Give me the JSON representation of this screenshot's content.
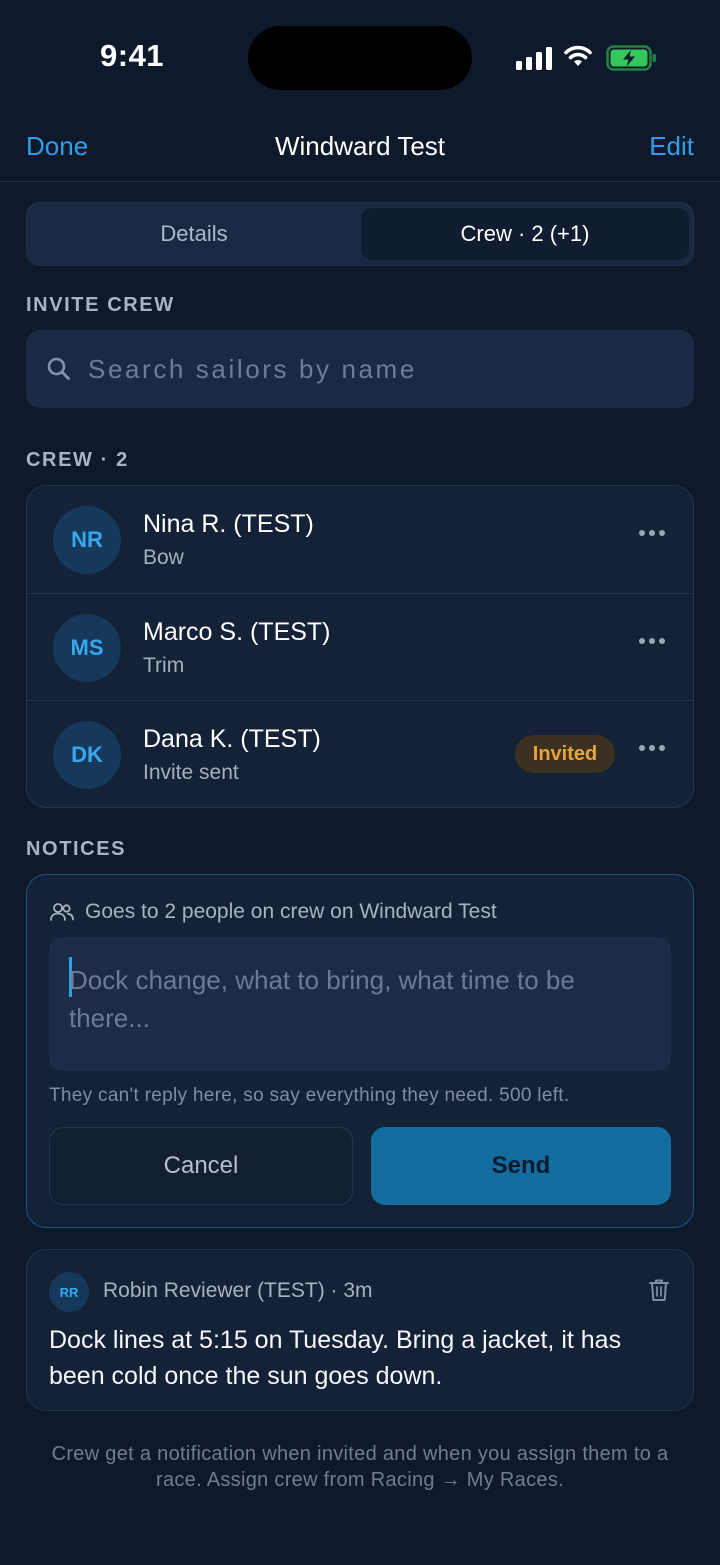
{
  "status_bar": {
    "time": "9:41"
  },
  "nav": {
    "done_label": "Done",
    "title": "Windward Test",
    "edit_label": "Edit"
  },
  "tabs": [
    {
      "label": "Details",
      "selected": false
    },
    {
      "label": "Crew · 2 (+1)",
      "selected": true
    }
  ],
  "invite": {
    "section_label": "INVITE CREW",
    "search_placeholder": "Search sailors by name"
  },
  "crew": {
    "section_label": "CREW · 2",
    "members": [
      {
        "initials": "NR",
        "name": "Nina R. (TEST)",
        "role": "Bow",
        "badge": ""
      },
      {
        "initials": "MS",
        "name": "Marco S. (TEST)",
        "role": "Trim",
        "badge": ""
      },
      {
        "initials": "DK",
        "name": "Dana K. (TEST)",
        "role": "Invite sent",
        "badge": "Invited"
      }
    ]
  },
  "notices": {
    "section_label": "NOTICES",
    "composer": {
      "audience": "Goes to 2 people on crew on Windward Test",
      "placeholder": "Dock change, what to bring, what time to be there...",
      "value": "",
      "hint": "They can't reply here, so say everything they need. 500 left.",
      "cancel_label": "Cancel",
      "send_label": "Send"
    },
    "posted": [
      {
        "initials": "RR",
        "author_line": "Robin Reviewer (TEST) · 3m",
        "body": "Dock lines at 5:15 on Tuesday. Bring a jacket, it has been cold once the sun goes down."
      }
    ]
  },
  "footer": "Crew get a notification when invited and when you assign them to a race. Assign crew from Racing → My Races.",
  "colors": {
    "background": "#0e1a2c",
    "accent": "#2e9fe6",
    "send_button": "#136d9f",
    "badge_text": "#e9a33a",
    "battery": "#34c759"
  },
  "icons": [
    "signal-icon",
    "wifi-icon",
    "battery-icon",
    "search-icon",
    "more-icon",
    "people-icon",
    "trash-icon"
  ]
}
